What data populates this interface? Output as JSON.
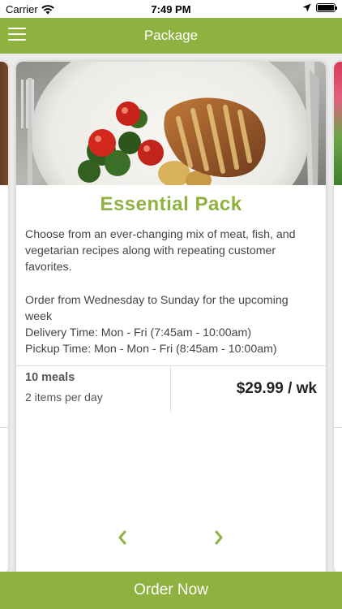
{
  "status_bar": {
    "carrier": "Carrier",
    "time": "7:49 PM",
    "icons": [
      "wifi-icon",
      "location-arrow-icon",
      "battery-icon"
    ]
  },
  "nav": {
    "title": "Package",
    "menu_icon": "hamburger-menu-icon"
  },
  "colors": {
    "brand_green": "#8fb13f",
    "text_dark": "#222222",
    "text_body": "#444444"
  },
  "package": {
    "name": "Essential Pack",
    "description_1": "Choose from an ever-changing mix of meat, fish, and vegetarian recipes along with repeating customer favorites.",
    "description_2": "Order from Wednesday to Sunday for the upcoming week",
    "delivery_time": "Delivery Time: Mon - Fri (7:45am - 10:00am)",
    "pickup_time": "Pickup Time: Mon - Mon - Fri (8:45am - 10:00am)",
    "meals": "10 meals",
    "items_per_day": "2 items per day",
    "price": "$29.99 / wk"
  },
  "carousel": {
    "prev_icon": "chevron-left-icon",
    "next_icon": "chevron-right-icon"
  },
  "order_button": {
    "label": "Order Now"
  }
}
